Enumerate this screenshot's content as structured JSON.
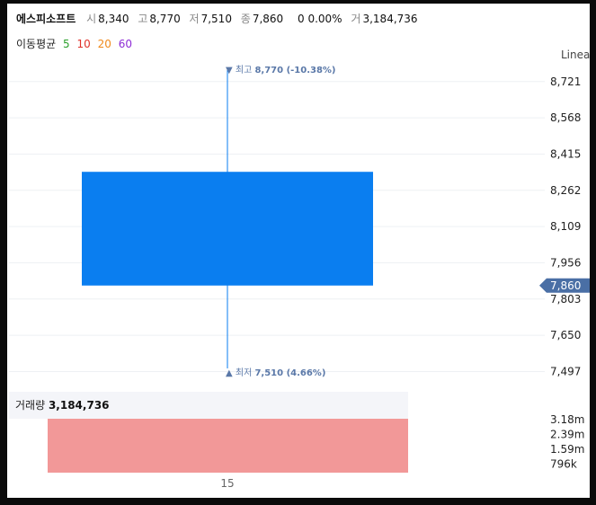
{
  "stock": {
    "name": "에스피소프트",
    "open_label": "시",
    "open": "8,340",
    "high_label": "고",
    "high": "8,770",
    "low_label": "저",
    "low": "7,510",
    "close_label": "종",
    "close": "7,860",
    "change": "0 0.00%",
    "volume_label": "거",
    "volume": "3,184,736"
  },
  "moving_average": {
    "label": "이동평균",
    "periods": [
      {
        "value": "5",
        "color": "#2ca02c"
      },
      {
        "value": "10",
        "color": "#e0322b"
      },
      {
        "value": "20",
        "color": "#f08a1c"
      },
      {
        "value": "60",
        "color": "#8e2bd6"
      }
    ]
  },
  "scale_mode": "Linea",
  "volume_panel": {
    "label": "거래량",
    "value": "3,184,736"
  },
  "chart_data": {
    "type": "candlestick",
    "candles": [
      {
        "x": "15",
        "open": 8340,
        "high": 8770,
        "low": 7510,
        "close": 7860,
        "volume": 3184736
      }
    ],
    "y_ticks": [
      "8,721",
      "8,568",
      "8,415",
      "8,262",
      "8,109",
      "7,956",
      "7,803",
      "7,650",
      "7,497"
    ],
    "y_tick_values": [
      8721,
      8568,
      8415,
      8262,
      8109,
      7956,
      7803,
      7650,
      7497
    ],
    "ylim": [
      7457,
      8815
    ],
    "current_price_label": "7,860",
    "current_price_color": "#4a6fa5",
    "high_annotation": {
      "prefix": "▼ 최고",
      "text": "8,770 (-10.38%)"
    },
    "low_annotation": {
      "prefix": "▲ 최저",
      "text": "7,510 (4.66%)"
    },
    "annotation_color": "#5a78a8",
    "candle_color": "#0a7ef0",
    "volume_ticks": [
      "3.18m",
      "2.39m",
      "1.59m",
      "796k"
    ],
    "volume_tick_values": [
      3184736,
      2388552,
      1592368,
      796184
    ],
    "volume_max": 3184736,
    "volume_color": "#f29898",
    "x_tick_labels": [
      "15"
    ],
    "grid": true
  }
}
